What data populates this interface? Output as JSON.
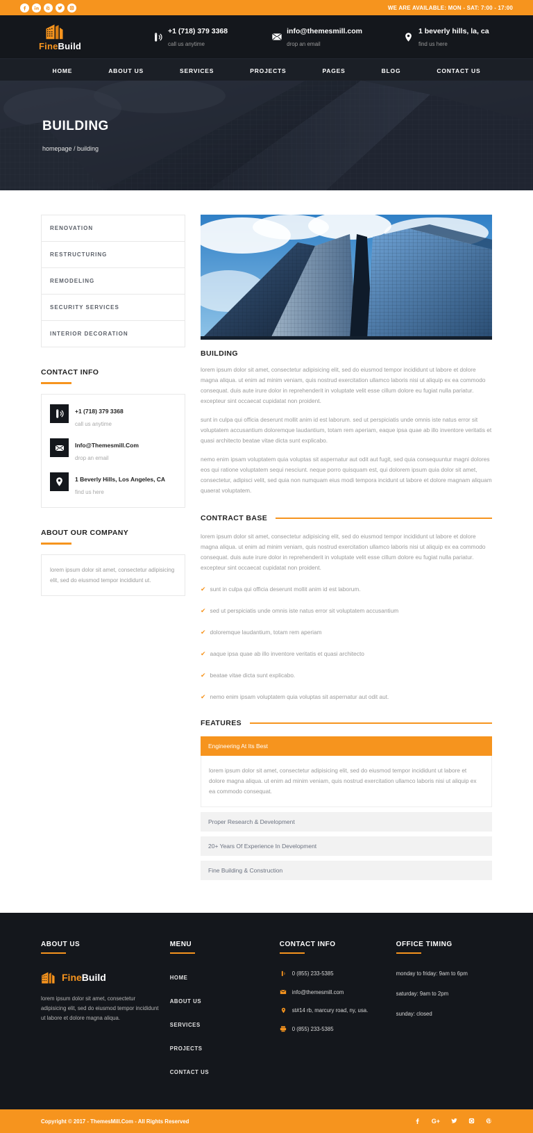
{
  "topbar": {
    "social": [
      {
        "name": "facebook-icon",
        "glyph": "f"
      },
      {
        "name": "linkedin-icon",
        "glyph": "in"
      },
      {
        "name": "pinterest-icon",
        "glyph": "p"
      },
      {
        "name": "twitter-icon",
        "glyph": "t"
      },
      {
        "name": "instagram-icon",
        "glyph": "o"
      }
    ],
    "availability": "WE ARE AVAILABLE: MON - SAT: 7:00 - 17:00"
  },
  "header": {
    "logo": {
      "part1": "Fine",
      "part2": "Build"
    },
    "contacts": [
      {
        "icon": "phone-icon",
        "title": "+1 (718) 379 3368",
        "subtitle": "call us anytime"
      },
      {
        "icon": "envelope-icon",
        "title": "info@themesmill.com",
        "subtitle": "drop an email"
      },
      {
        "icon": "map-pin-icon",
        "title": "1 beverly hills, la, ca",
        "subtitle": "find us here"
      }
    ]
  },
  "nav": {
    "items": [
      "HOME",
      "ABOUT US",
      "SERVICES",
      "PROJECTS",
      "PAGES",
      "BLOG",
      "CONTACT US"
    ]
  },
  "hero": {
    "title": "BUILDING",
    "breadcrumb": "homepage / building"
  },
  "sidebar": {
    "categories": [
      "RENOVATION",
      "RESTRUCTURING",
      "REMODELING",
      "SECURITY SERVICES",
      "INTERIOR DECORATION"
    ],
    "contact_title": "CONTACT INFO",
    "contacts": [
      {
        "icon": "phone-icon",
        "title": "+1 (718) 379 3368",
        "subtitle": "call us anytime"
      },
      {
        "icon": "envelope-icon",
        "title": "Info@Themesmill.Com",
        "subtitle": "drop an email"
      },
      {
        "icon": "map-pin-icon",
        "title": "1 Beverly Hills, Los Angeles, CA",
        "subtitle": "find us here"
      }
    ],
    "about_title": "ABOUT OUR COMPANY",
    "about_text": "lorem ipsum dolor sit amet, consectetur adipisicing elit, sed do eiusmod tempor incididunt ut."
  },
  "main": {
    "image_alt": "glass office towers",
    "title": "BUILDING",
    "paragraphs": [
      "lorem ipsum dolor sit amet, consectetur adipisicing elit, sed do eiusmod tempor incididunt ut labore et dolore magna aliqua. ut enim ad minim veniam, quis nostrud exercitation ullamco laboris nisi ut aliquip ex ea commodo consequat. duis aute irure dolor in reprehenderit in voluptate velit esse cillum dolore eu fugiat nulla pariatur. excepteur sint occaecat cupidatat non proident.",
      "sunt in culpa qui officia deserunt mollit anim id est laborum. sed ut perspiciatis unde omnis iste natus error sit voluptatem accusantium doloremque laudantium, totam rem aperiam, eaque ipsa quae ab illo inventore veritatis et quasi architecto beatae vitae dicta sunt explicabo.",
      "nemo enim ipsam voluptatem quia voluptas sit aspernatur aut odit aut fugit, sed quia consequuntur magni dolores eos qui ratione voluptatem sequi nesciunt. neque porro quisquam est, qui dolorem ipsum quia dolor sit amet, consectetur, adipisci velit, sed quia non numquam eius modi tempora incidunt ut labore et dolore magnam aliquam quaerat voluptatem."
    ],
    "contract": {
      "title": "CONTRACT BASE",
      "paragraph": "lorem ipsum dolor sit amet, consectetur adipisicing elit, sed do eiusmod tempor incididunt ut labore et dolore magna aliqua. ut enim ad minim veniam, quis nostrud exercitation ullamco laboris nisi ut aliquip ex ea commodo consequat. duis aute irure dolor in reprehenderit in voluptate velit esse cillum dolore eu fugiat nulla pariatur. excepteur sint occaecat cupidatat non proident.",
      "items": [
        "sunt in culpa qui officia deserunt mollit anim id est laborum.",
        "sed ut perspiciatis unde omnis iste natus error sit voluptatem accusantium",
        "doloremque laudantium, totam rem aperiam",
        "aaque ipsa quae ab illo inventore veritatis et quasi architecto",
        "beatae vitae dicta sunt explicabo.",
        "nemo enim ipsam voluptatem quia voluptas sit aspernatur aut odit aut."
      ]
    },
    "features": {
      "title": "FEATURES",
      "items": [
        {
          "label": "Engineering At Its Best",
          "open": true,
          "body": "lorem ipsum dolor sit amet, consectetur adipisicing elit, sed do eiusmod tempor incididunt ut labore et dolore magna aliqua. ut enim ad minim veniam, quis nostrud exercitation ullamco laboris nisi ut aliquip ex ea commodo consequat."
        },
        {
          "label": "Proper Research & Development",
          "open": false,
          "body": ""
        },
        {
          "label": "20+ Years Of Experience In Development",
          "open": false,
          "body": ""
        },
        {
          "label": "Fine Building & Construction",
          "open": false,
          "body": ""
        }
      ]
    }
  },
  "footer": {
    "about": {
      "heading": "ABOUT US",
      "logo": {
        "part1": "Fine",
        "part2": "Build"
      },
      "text": "lorem ipsum dolor sit amet, consectetur adipisicing elit, sed do eiusmod tempor incididunt ut labore et dolore magna aliqua."
    },
    "menu": {
      "heading": "MENU",
      "items": [
        "HOME",
        "ABOUT US",
        "SERVICES",
        "PROJECTS",
        "CONTACT US"
      ]
    },
    "contact": {
      "heading": "CONTACT INFO",
      "items": [
        {
          "icon": "phone-icon",
          "text": "0 (855) 233-5385"
        },
        {
          "icon": "envelope-icon",
          "text": "info@themesmill.com"
        },
        {
          "icon": "map-pin-icon",
          "text": "st#14 rb, marcury road, ny, usa."
        },
        {
          "icon": "fax-icon",
          "text": "0 (855) 233-5385"
        }
      ]
    },
    "timing": {
      "heading": "OFFICE TIMING",
      "items": [
        "monday to friday: 9am to 6pm",
        "saturday: 9am to 2pm",
        "sunday: closed"
      ]
    }
  },
  "bottombar": {
    "copyright": "Copyright © 2017 - ThemesMill.Com - All Rights Reserved",
    "social": [
      {
        "name": "facebook-icon",
        "glyph": "f"
      },
      {
        "name": "google-plus-icon",
        "glyph": "G+"
      },
      {
        "name": "twitter-icon",
        "glyph": "t"
      },
      {
        "name": "instagram-icon",
        "glyph": "o"
      },
      {
        "name": "pinterest-icon",
        "glyph": "p"
      }
    ]
  },
  "colors": {
    "accent": "#f6941e",
    "dark": "#14171c",
    "nav_dark": "#1b1f26"
  }
}
